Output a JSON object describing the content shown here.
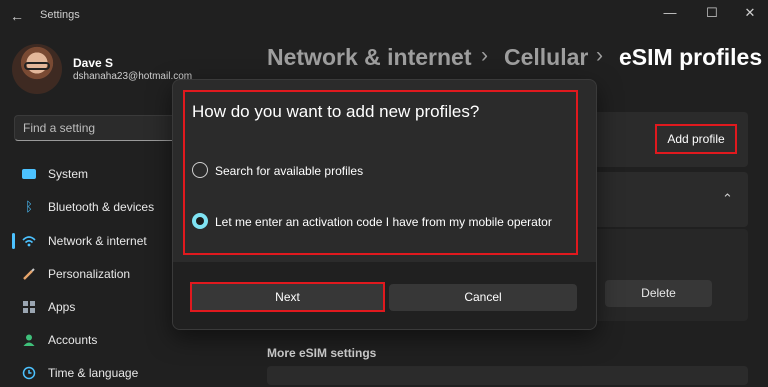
{
  "window": {
    "title": "Settings",
    "minimize": "—",
    "maximize": "☐",
    "close": "✕",
    "back": "←"
  },
  "user": {
    "name": "Dave S",
    "email": "dshanaha23@hotmail.com"
  },
  "search": {
    "placeholder": "Find a setting"
  },
  "sidebar": {
    "items": [
      {
        "label": "System",
        "icon": "monitor-icon",
        "color": "#4cc2ff"
      },
      {
        "label": "Bluetooth & devices",
        "icon": "bluetooth-icon",
        "color": "#4cc2ff"
      },
      {
        "label": "Network & internet",
        "icon": "wifi-icon",
        "color": "#4cc2ff",
        "active": true
      },
      {
        "label": "Personalization",
        "icon": "brush-icon",
        "color": "#e8a56b"
      },
      {
        "label": "Apps",
        "icon": "apps-icon",
        "color": "#9aa5b1"
      },
      {
        "label": "Accounts",
        "icon": "person-icon",
        "color": "#3fc07a"
      },
      {
        "label": "Time & language",
        "icon": "globe-clock-icon",
        "color": "#4cc2ff"
      }
    ]
  },
  "breadcrumb": {
    "part1": "Network & internet",
    "part2": "Cellular",
    "part3": "eSIM profiles",
    "sep": "›"
  },
  "main": {
    "add_profile": "Add profile",
    "delete": "Delete",
    "more_esim": "More eSIM settings",
    "chevron": "⌃"
  },
  "dialog": {
    "title": "How do you want to add new profiles?",
    "option1": "Search for available profiles",
    "option2": "Let me enter an activation code I have from my mobile operator",
    "selected": 2,
    "next": "Next",
    "cancel": "Cancel"
  },
  "colors": {
    "accent": "#4cc2ff",
    "highlight": "#e0191e",
    "radio_selected": "#7fe3f3"
  }
}
